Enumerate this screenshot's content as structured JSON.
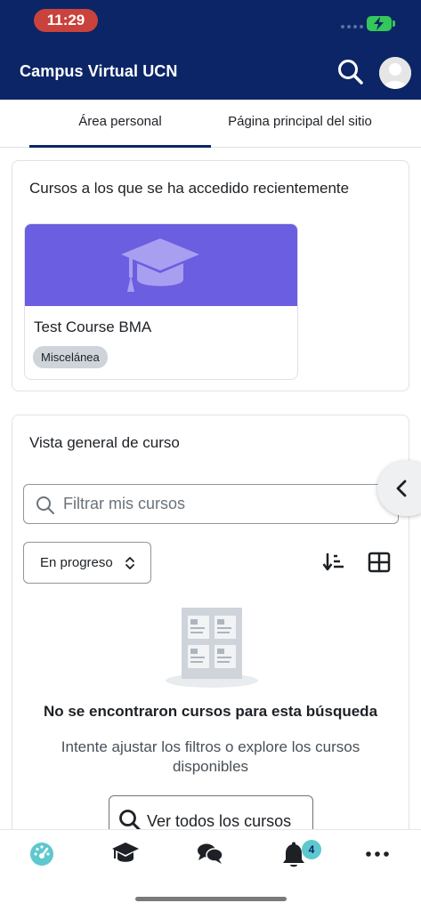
{
  "status_bar": {
    "time": "11:29"
  },
  "header": {
    "title": "Campus Virtual UCN"
  },
  "tabs": [
    {
      "label": "Área personal",
      "active": true
    },
    {
      "label": "Página principal del sitio",
      "active": false
    }
  ],
  "recent": {
    "title": "Cursos a los que se ha accedido recientemente",
    "course": {
      "name": "Test Course BMA",
      "category": "Miscelánea"
    }
  },
  "overview": {
    "title": "Vista general de curso",
    "filter_placeholder": "Filtrar mis cursos",
    "progress_filter": "En progreso",
    "empty_title": "No se encontraron cursos para esta búsqueda",
    "empty_description": "Intente ajustar los filtros o explore los cursos disponibles",
    "view_all_label": "Ver todos los cursos"
  },
  "bottom_nav": {
    "notifications_count": "4"
  },
  "colors": {
    "header_bg": "#0b2566",
    "course_image_bg": "#6b5ee0",
    "badge_bg": "#ced4da",
    "accent_teal": "#5ec8cf",
    "status_time_bg": "#c9423c"
  },
  "icons": [
    "search-icon",
    "avatar-icon",
    "graduation-cap-icon",
    "magnifier-icon",
    "chevron-up-down-icon",
    "sort-icon",
    "grid-icon",
    "chevron-left-icon",
    "dashboard-icon",
    "courses-icon",
    "chat-icon",
    "bell-icon",
    "more-icon"
  ]
}
